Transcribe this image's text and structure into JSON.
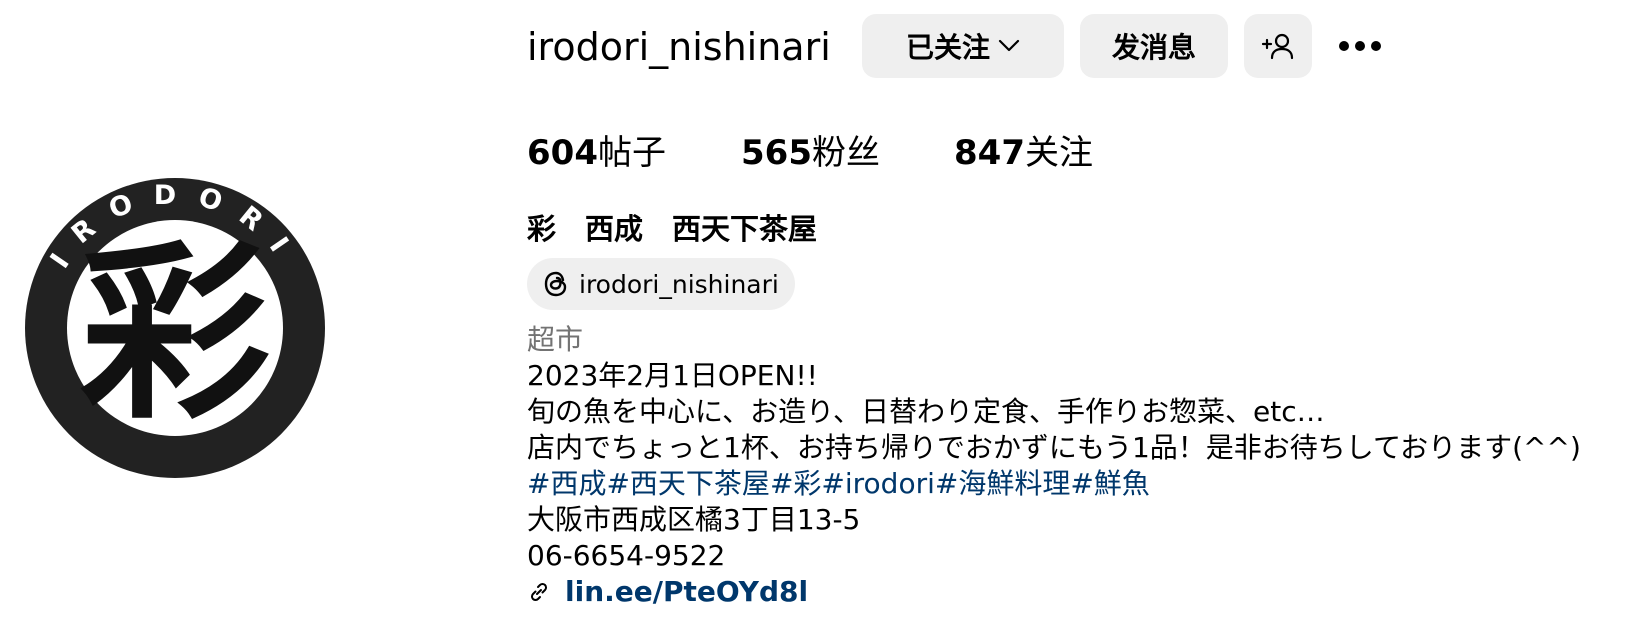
{
  "profile": {
    "username": "irodori_nishinari",
    "follow_button": "已关注",
    "message_button": "发消息",
    "stats": {
      "posts_count": "604",
      "posts_label": "帖子",
      "followers_count": "565",
      "followers_label": "粉丝",
      "following_count": "847",
      "following_label": "关注"
    },
    "display_name": "彩　西成　西天下茶屋",
    "threads_handle": "irodori_nishinari",
    "category": "超市",
    "bio": {
      "line1": "2023年2月1日OPEN!!",
      "line2": "旬の魚を中心に、お造り、日替わり定食、手作りお惣菜、etc…",
      "line3": "店内でちょっと1杯、お持ち帰りでおかずにもう1品！是非お待ちしております(^^)",
      "hashtags": [
        "#西成",
        "#西天下茶屋",
        "#彩",
        "#irodori",
        "#海鮮料理",
        "#鮮魚"
      ],
      "address": "大阪市西成区橘3丁目13-5",
      "phone": "06-6654-9522",
      "link": "lin.ee/PteOYd8l"
    },
    "avatar_logo": {
      "ring_text": "IRODORI",
      "center_char": "彩"
    }
  },
  "icons": {
    "follow_chevron": "chevron-down-icon",
    "add_user": "person-add-icon",
    "more": "more-options-icon",
    "threads": "threads-icon",
    "link": "link-icon"
  },
  "colors": {
    "button_bg": "#efefef",
    "hashtag": "#00376b",
    "category": "#737373",
    "logo_dark": "#222222"
  }
}
